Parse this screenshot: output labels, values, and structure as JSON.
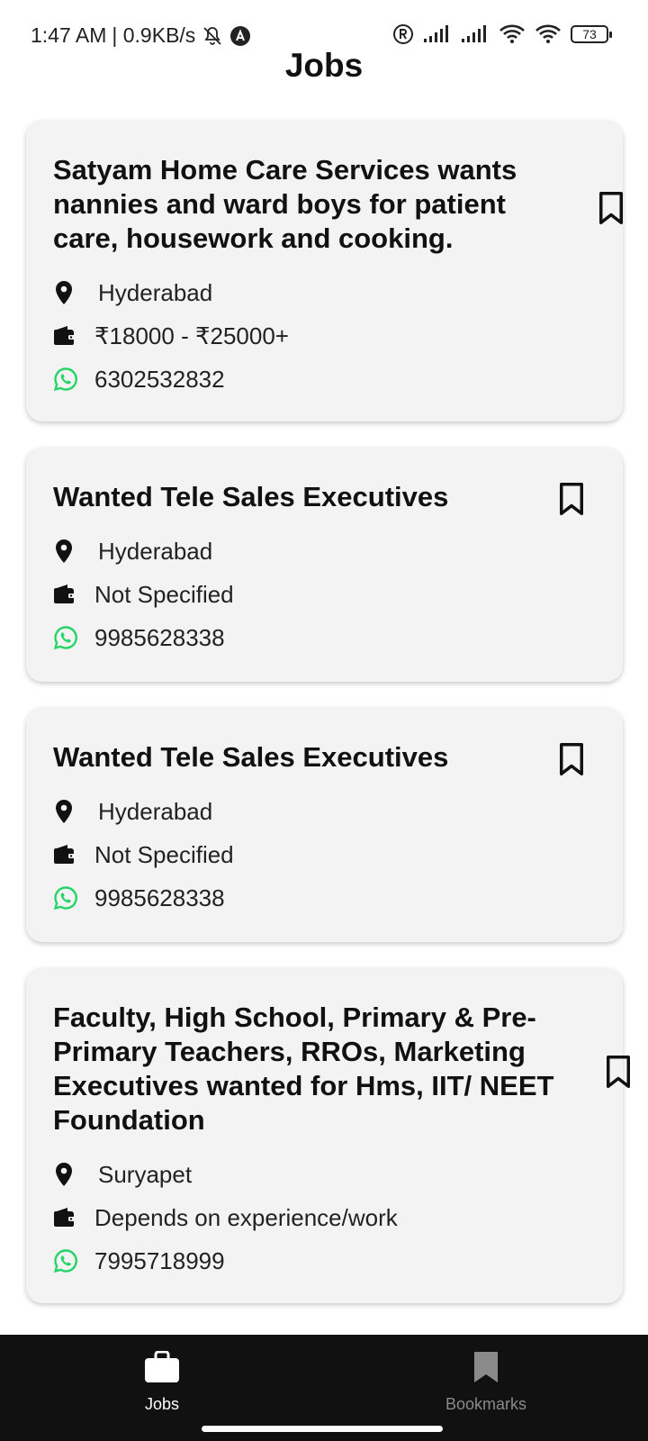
{
  "status_bar": {
    "time": "1:47 AM",
    "speed": "| 0.9KB/s",
    "battery": "73",
    "icons": [
      "bell-off-icon",
      "app-a-icon",
      "registered-icon",
      "signal-icon",
      "signal-icon",
      "wifi-icon",
      "wifi-icon",
      "battery-icon"
    ]
  },
  "page": {
    "title": "Jobs"
  },
  "jobs": [
    {
      "title": "Satyam Home Care Services wants nannies and ward boys for patient care, housework and cooking.",
      "location": "Hyderabad",
      "salary": "₹18000 - ₹25000+",
      "phone": "6302532832"
    },
    {
      "title": "Wanted Tele Sales Executives",
      "location": "Hyderabad",
      "salary": "Not Specified",
      "phone": "9985628338"
    },
    {
      "title": "Wanted Tele Sales Executives",
      "location": "Hyderabad",
      "salary": "Not Specified",
      "phone": "9985628338"
    },
    {
      "title": "Faculty, High School, Primary & Pre-Primary Teachers, RROs, Marketing Executives wanted for Hms, IIT/ NEET Foundation",
      "location": "Suryapet",
      "salary": "Depends on experience/work",
      "phone": "7995718999"
    }
  ],
  "bottom_nav": {
    "jobs_label": "Jobs",
    "bookmarks_label": "Bookmarks"
  },
  "colors": {
    "whatsapp": "#25D366",
    "card_bg": "#f3f3f3",
    "nav_bg": "#111111",
    "nav_active": "#ffffff",
    "nav_inactive": "#8a8a8a"
  }
}
